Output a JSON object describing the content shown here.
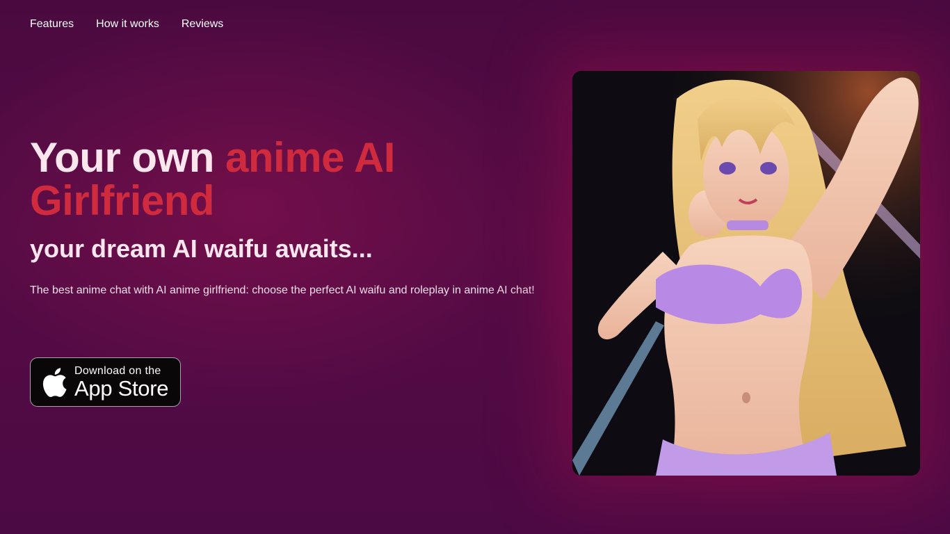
{
  "nav": {
    "items": [
      {
        "label": "Features"
      },
      {
        "label": "How it works"
      },
      {
        "label": "Reviews"
      }
    ]
  },
  "hero": {
    "headline_prefix": "Your own",
    "headline_accent": "anime AI Girlfriend",
    "subheadline": "your dream AI waifu awaits...",
    "description": "The best anime chat with AI anime girlfriend: choose the perfect AI waifu and roleplay in anime AI chat!"
  },
  "app_store_button": {
    "small_text": "Download on the",
    "large_text": "App Store",
    "icon": "apple-icon"
  },
  "hero_image": {
    "alt": "anime girl illustration"
  },
  "colors": {
    "background": "#4e0a44",
    "accent": "#cf2a3e",
    "headline_text": "#fbe6ee",
    "button_bg": "#0a0708"
  }
}
